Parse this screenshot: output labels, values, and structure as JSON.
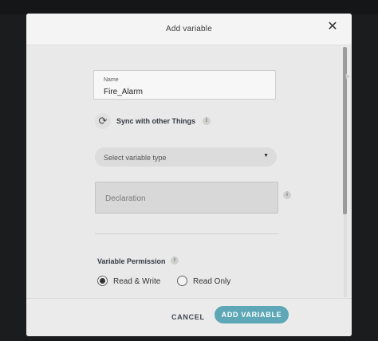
{
  "dialog": {
    "title": "Add variable",
    "close_icon": "close-icon"
  },
  "form": {
    "name": {
      "label": "Name",
      "value": "Fire_Alarm"
    },
    "sync": {
      "icon": "sync-icon",
      "label": "Sync with other Things",
      "info_icon": "info-icon"
    },
    "variable_type": {
      "placeholder": "Select variable type",
      "caret_icon": "chevron-down-icon"
    },
    "declaration": {
      "placeholder": "Declaration",
      "info_icon": "info-icon"
    },
    "permission": {
      "title": "Variable Permission",
      "info_icon": "info-icon",
      "options": [
        {
          "label": "Read & Write",
          "selected": true
        },
        {
          "label": "Read Only",
          "selected": false
        }
      ]
    }
  },
  "footer": {
    "cancel_label": "CANCEL",
    "add_label": "ADD VARIABLE"
  },
  "colors": {
    "accent": "#5ea7b6",
    "dialog_bg": "#ececec",
    "backdrop": "#1b1c1e"
  }
}
